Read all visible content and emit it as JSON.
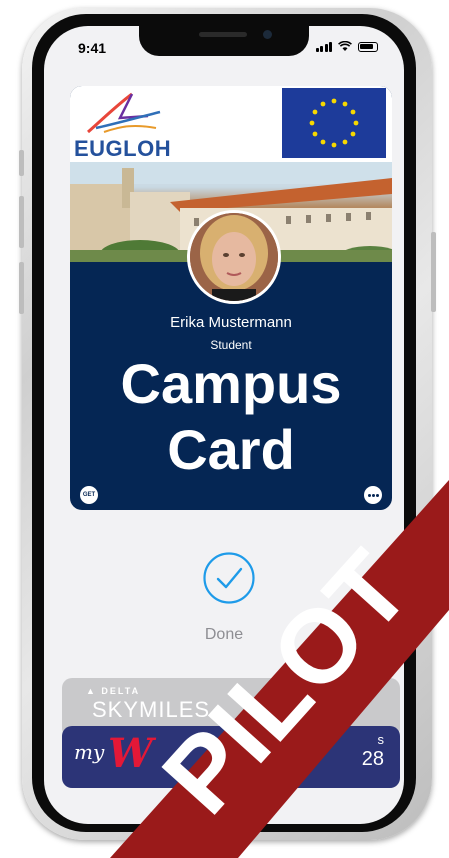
{
  "status": {
    "time": "9:41"
  },
  "card": {
    "logo_text": "EUGLOH",
    "name": "Erika Mustermann",
    "role": "Student",
    "title_line1": "Campus",
    "title_line2": "Card",
    "get_label": "GET",
    "accent_color": "#052654"
  },
  "done": {
    "label": "Done",
    "color": "#1e9be9"
  },
  "passes": {
    "delta_small": "▲ DELTA",
    "delta_name": "SKYMILES",
    "walgreens_my": "my",
    "walgreens_w": "W",
    "walgreens_points_suffix": "s",
    "walgreens_number": "28"
  },
  "overlay": {
    "pilot_label": "PILOT",
    "band_color": "#9a1a1a"
  }
}
